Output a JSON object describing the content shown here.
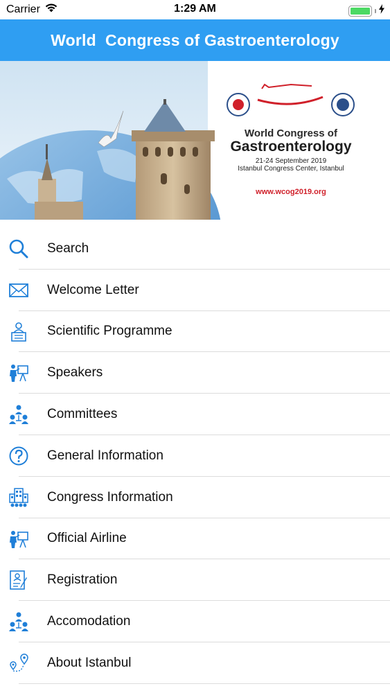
{
  "status_bar": {
    "carrier": "Carrier",
    "time": "1:29 AM"
  },
  "header": {
    "title": "World  Congress of Gastroenterology"
  },
  "banner": {
    "line1": "World Congress of",
    "line2": "Gastroenterology",
    "dates": "21-24 September 2019",
    "venue": "Istanbul Congress Center, Istanbul",
    "url": "www.wcog2019.org"
  },
  "menu": {
    "items": [
      {
        "label": "Search",
        "icon": "search-icon"
      },
      {
        "label": "Welcome Letter",
        "icon": "envelope-icon"
      },
      {
        "label": "Scientific Programme",
        "icon": "lecturer-icon"
      },
      {
        "label": "Speakers",
        "icon": "presenter-icon"
      },
      {
        "label": "Committees",
        "icon": "team-icon"
      },
      {
        "label": "General Information",
        "icon": "question-icon"
      },
      {
        "label": "Congress Information",
        "icon": "building-icon"
      },
      {
        "label": "Official Airline",
        "icon": "presenter-icon"
      },
      {
        "label": "Registration",
        "icon": "id-card-icon"
      },
      {
        "label": "Accomodation",
        "icon": "team-icon"
      },
      {
        "label": "About Istanbul",
        "icon": "location-route-icon"
      }
    ]
  },
  "colors": {
    "header_bg": "#2f9ef2",
    "icon_blue": "#1f7fd8",
    "battery": "#4cd964",
    "url_red": "#d0202a"
  }
}
